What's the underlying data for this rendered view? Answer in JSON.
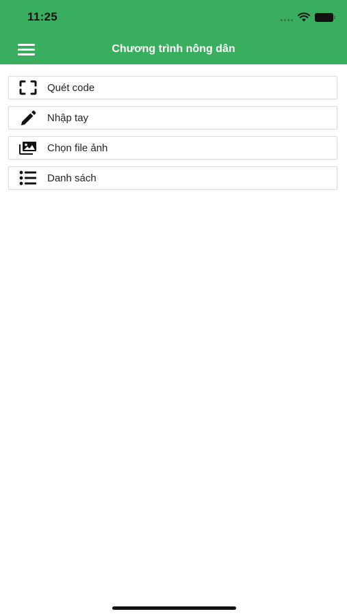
{
  "status_bar": {
    "time": "11:25"
  },
  "header": {
    "title": "Chương trình nông dân",
    "background_color": "#3aae5f",
    "menu_icon": "hamburger-menu-icon"
  },
  "menu": {
    "items": [
      {
        "label": "Quét code",
        "icon": "scan-frame-icon"
      },
      {
        "label": "Nhập tay",
        "icon": "pencil-icon"
      },
      {
        "label": "Chọn file ảnh",
        "icon": "image-gallery-icon"
      },
      {
        "label": "Danh sách",
        "icon": "list-icon"
      }
    ]
  }
}
